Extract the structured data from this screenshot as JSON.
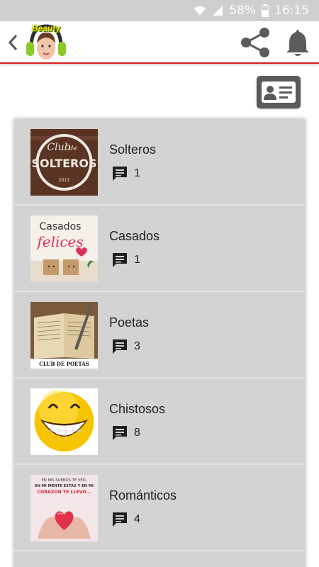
{
  "status_bar": {
    "battery": "58%",
    "time": "16:15"
  },
  "app_bar": {
    "logo_text": "Beauty",
    "icons": [
      "chevron-left-icon",
      "share-icon",
      "bell-icon"
    ]
  },
  "contact_button": {
    "icon": "contact-card-icon"
  },
  "groups": [
    {
      "name": "Solteros",
      "count": "1"
    },
    {
      "name": "Casados",
      "count": "1"
    },
    {
      "name": "Poetas",
      "count": "3"
    },
    {
      "name": "Chistosos",
      "count": "8"
    },
    {
      "name": "Románticos",
      "count": "4"
    }
  ],
  "thumbnails": {
    "solteros": {
      "line1": "Club",
      "line2": "de",
      "line3": "SOLTEROS",
      "year": "2013"
    },
    "casados": {
      "line1": "Casados",
      "line2": "felices"
    },
    "poetas": {
      "caption": "CLUB DE POETAS"
    },
    "romanticos": {
      "line1": "EN MIS SUEÑOS TE VEO,",
      "line2": "EN MI MENTE ESTAS Y EN MI",
      "line3": "CORAZON TE LLEVO..."
    }
  },
  "colors": {
    "accent": "#d62020",
    "card_bg": "#d3d3d3",
    "icon_dark": "#1e1e1e"
  }
}
